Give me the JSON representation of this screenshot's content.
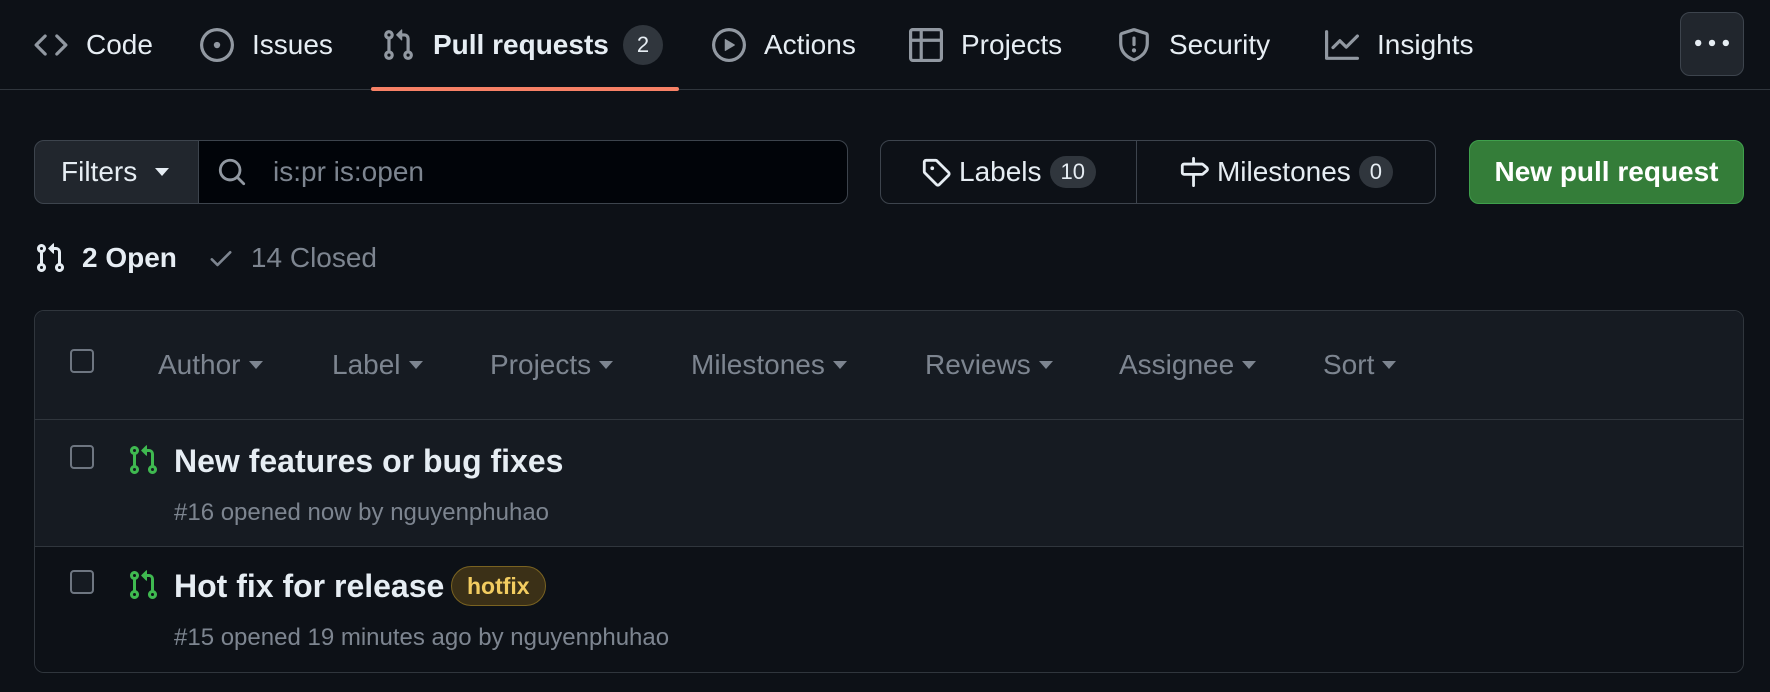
{
  "repo_nav": {
    "tabs": [
      {
        "label": "Code",
        "icon": "code-icon"
      },
      {
        "label": "Issues",
        "icon": "issue-opened-icon"
      },
      {
        "label": "Pull requests",
        "icon": "git-pull-request-icon",
        "counter": "2",
        "selected": true
      },
      {
        "label": "Actions",
        "icon": "play-icon"
      },
      {
        "label": "Projects",
        "icon": "table-icon"
      },
      {
        "label": "Security",
        "icon": "shield-icon"
      },
      {
        "label": "Insights",
        "icon": "graph-icon"
      }
    ],
    "more_icon": "kebab-horizontal-icon"
  },
  "toolbar": {
    "filters_label": "Filters",
    "search": {
      "placeholder": "is:pr is:open",
      "value": ""
    },
    "labels": {
      "label": "Labels",
      "count": "10"
    },
    "milestones": {
      "label": "Milestones",
      "count": "0"
    },
    "new_pr_label": "New pull request"
  },
  "states": {
    "open": "2 Open",
    "closed": "14 Closed"
  },
  "list_header": {
    "filters": [
      "Author",
      "Label",
      "Projects",
      "Milestones",
      "Reviews",
      "Assignee",
      "Sort"
    ]
  },
  "pull_requests": [
    {
      "title": "New features or bug fixes",
      "meta_prefix": "#16 opened now by",
      "author": "nguyenphuhao",
      "labels": []
    },
    {
      "title": "Hot fix for release",
      "meta_prefix": "#15 opened 19 minutes ago by",
      "author": "nguyenphuhao",
      "labels": [
        "hotfix"
      ]
    }
  ],
  "colors": {
    "background": "#0d1117",
    "selected_tab_underline": "#f78166",
    "open_pr_icon": "#3fb950",
    "primary_button": "#347d39",
    "hotfix_label_text": "#f2cc60"
  }
}
